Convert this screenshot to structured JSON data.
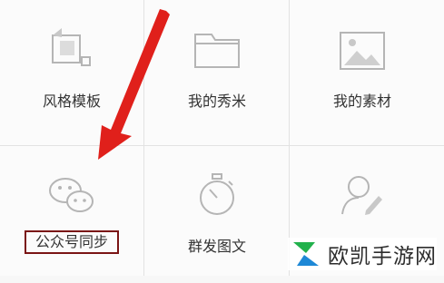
{
  "grid": {
    "row1": [
      {
        "label": "风格模板",
        "icon": "template-icon"
      },
      {
        "label": "我的秀米",
        "icon": "folder-icon"
      },
      {
        "label": "我的素材",
        "icon": "image-icon"
      }
    ],
    "row2": [
      {
        "label": "公众号同步",
        "icon": "wechat-icon",
        "highlighted": true
      },
      {
        "label": "群发图文",
        "icon": "stopwatch-icon"
      },
      {
        "label": "",
        "icon": "user-edit-icon"
      }
    ]
  },
  "annotation": {
    "arrow_color": "#e0201b",
    "box_color": "#7a1414"
  },
  "watermark": {
    "text": "欧凯手游网",
    "logo_colors": [
      "#22b14c",
      "#1e88d6"
    ]
  }
}
